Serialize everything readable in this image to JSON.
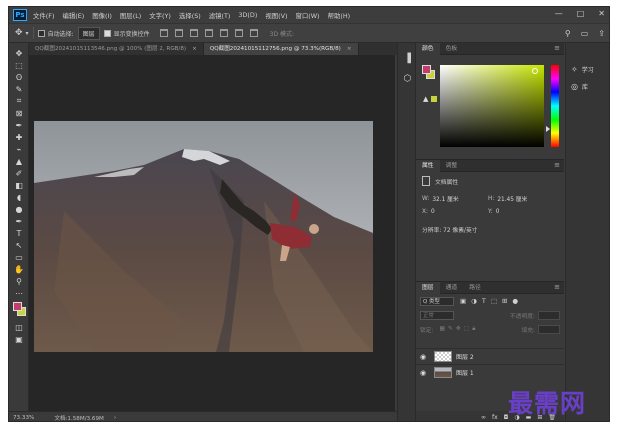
{
  "app": {
    "logo": "Ps"
  },
  "menu": [
    "文件(F)",
    "编辑(E)",
    "图像(I)",
    "图层(L)",
    "文字(Y)",
    "选择(S)",
    "滤镜(T)",
    "3D(D)",
    "视图(V)",
    "窗口(W)",
    "帮助(H)"
  ],
  "window_controls": {
    "minimize": "—",
    "maximize": "□",
    "close": "✕"
  },
  "options_bar": {
    "auto_select_label": "自动选择:",
    "auto_select_value": "图层",
    "show_transform_label": "显示变换控件",
    "mode_3d_label": "3D 模式:"
  },
  "tools": [
    "✥",
    "⬚",
    "ʘ",
    "✎",
    "⌗",
    "⊠",
    "✒",
    "✚",
    "⌁",
    "▲",
    "✐",
    "◧",
    "◖",
    "●",
    "✒",
    "T",
    "↖",
    "▭",
    "✋",
    "⚲",
    "⋯"
  ],
  "tabs": [
    {
      "label": "QQ截图20241015113546.png @ 100% (图层 2, RGB/8)",
      "close": "×",
      "active": false
    },
    {
      "label": "QQ截图20241015112756.png @ 73.3%(RGB/8)",
      "close": "×",
      "active": true
    }
  ],
  "status": {
    "zoom": "73.33%",
    "doc": "文档:1.58M/3.69M",
    "arrow": "›"
  },
  "color_panel": {
    "tabs": [
      "颜色",
      "色板"
    ],
    "foreground": "#c43c6a",
    "background": "#c8d23c"
  },
  "properties_panel": {
    "tabs": [
      "属性",
      "调整"
    ],
    "title": "文档属性",
    "w_label": "W:",
    "w_value": "32.1 厘米",
    "h_label": "H:",
    "h_value": "21.45 厘米",
    "x_label": "X:",
    "x_value": "0",
    "y_label": "Y:",
    "y_value": "0",
    "resolution": "分辨率: 72 像素/英寸"
  },
  "layers_panel": {
    "tabs": [
      "图层",
      "通道",
      "路径"
    ],
    "filter_kind": "Q 类型",
    "blend_mode": "正常",
    "opacity_label": "不透明度:",
    "lock_label": "锁定:",
    "fill_label": "填充:",
    "layers": [
      {
        "name": "图层 2",
        "visible": true,
        "thumb": "checker"
      },
      {
        "name": "图层 1",
        "visible": true,
        "thumb": "mountain"
      }
    ]
  },
  "side_panels": [
    {
      "icon": "lightbulb-icon",
      "glyph": "✧",
      "label": "学习"
    },
    {
      "icon": "library-icon",
      "glyph": "◎",
      "label": "库"
    }
  ],
  "watermark": "最需网"
}
